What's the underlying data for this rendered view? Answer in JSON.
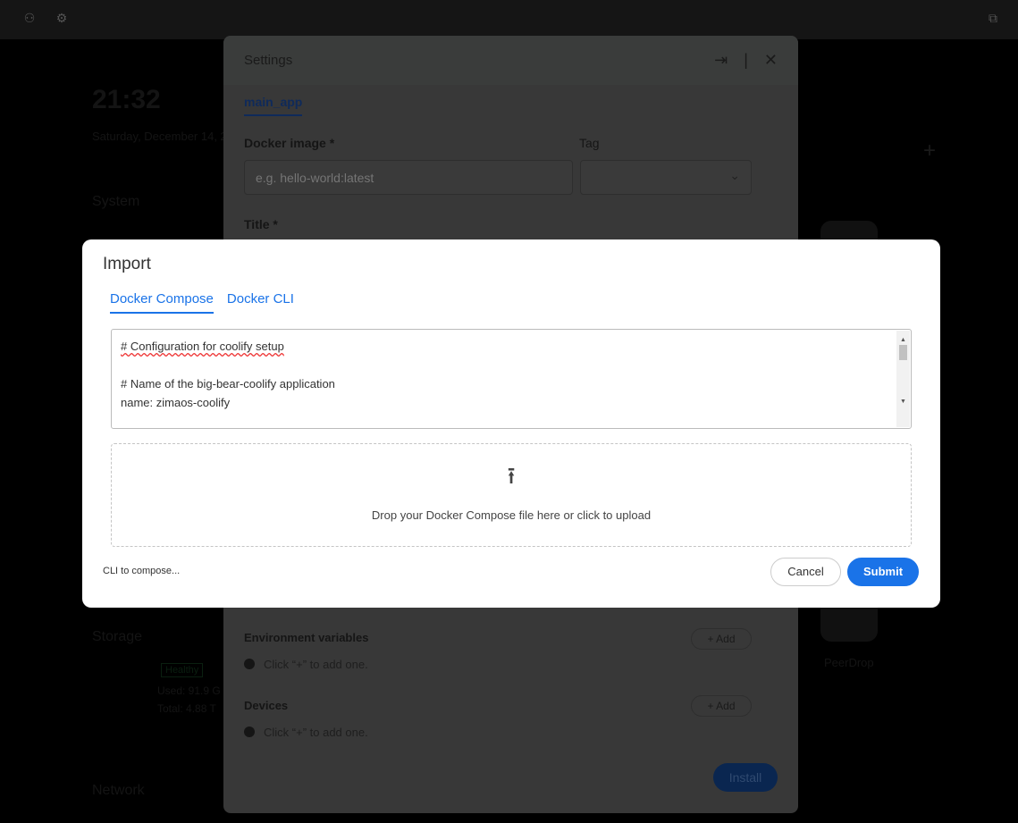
{
  "background": {
    "time": "21:32",
    "date": "Saturday, December 14, 2",
    "system_label": "System",
    "storage_label": "Storage",
    "storage_status": "Healthy",
    "storage_used": "Used: 91.9 G",
    "storage_total": "Total: 4.88 T",
    "network_label": "Network",
    "app_label": "PeerDrop"
  },
  "settings": {
    "title": "Settings",
    "tab": "main_app",
    "docker_image_label": "Docker image *",
    "docker_image_placeholder": "e.g. hello-world:latest",
    "tag_label": "Tag",
    "title_label": "Title *",
    "env_label": "Environment variables",
    "env_hint": "Click “+” to add one.",
    "devices_label": "Devices",
    "devices_hint": "Click “+” to add one.",
    "add_label": "+ Add",
    "install_label": "Install"
  },
  "import": {
    "title": "Import",
    "tabs": [
      {
        "label": "Docker Compose",
        "active": true
      },
      {
        "label": "Docker CLI",
        "active": false
      }
    ],
    "content_lines": [
      "# Configuration for coolify setup",
      "",
      "# Name of the big-bear-coolify application",
      "name: zimaos-coolify"
    ],
    "drop_text": "Drop your Docker Compose file here or click to upload",
    "cli_link": "CLI to compose...",
    "cancel_label": "Cancel",
    "submit_label": "Submit",
    "accent": "#1a73e8"
  }
}
